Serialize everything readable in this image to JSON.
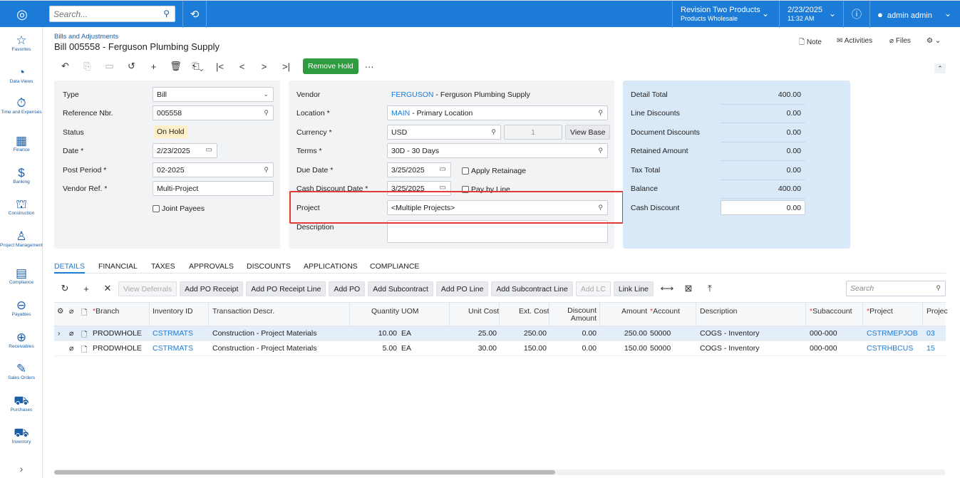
{
  "topbar": {
    "search_placeholder": "Search...",
    "company": "Revision Two Products",
    "branch": "Products Wholesale",
    "date": "2/23/2025",
    "time": "11:32 AM",
    "user": "admin admin"
  },
  "sidebar": [
    {
      "label": "Favorites",
      "icon": "star-icon",
      "glyph": "☆"
    },
    {
      "label": "Data Views",
      "icon": "pie-chart-icon",
      "glyph": "◔"
    },
    {
      "label": "Time and Expenses",
      "icon": "stopwatch-icon",
      "glyph": "⏱"
    },
    {
      "label": "Finance",
      "icon": "calculator-icon",
      "glyph": "▦"
    },
    {
      "label": "Banking",
      "icon": "dollar-icon",
      "glyph": "$"
    },
    {
      "label": "Construction",
      "icon": "crane-icon",
      "glyph": "⛫"
    },
    {
      "label": "Project Management",
      "icon": "people-icon",
      "glyph": "♙"
    },
    {
      "label": "Compliance",
      "icon": "document-icon",
      "glyph": "▤"
    },
    {
      "label": "Payables",
      "icon": "minus-circle-icon",
      "glyph": "⊖"
    },
    {
      "label": "Receivables",
      "icon": "plus-circle-icon",
      "glyph": "⊕"
    },
    {
      "label": "Sales Orders",
      "icon": "pencil-icon",
      "glyph": "✎"
    },
    {
      "label": "Purchases",
      "icon": "cart-icon",
      "glyph": "⛟"
    },
    {
      "label": "Inventory",
      "icon": "truck-icon",
      "glyph": "⛟"
    }
  ],
  "header": {
    "breadcrumb": "Bills and Adjustments",
    "title": "Bill 005558 - Ferguson Plumbing Supply",
    "note": "Note",
    "activities": "Activities",
    "files": "Files"
  },
  "toolbar": {
    "remove_hold": "Remove Hold",
    "more": "···"
  },
  "form": {
    "type_label": "Type",
    "type_value": "Bill",
    "ref_label": "Reference Nbr.",
    "ref_value": "005558",
    "status_label": "Status",
    "status_value": "On Hold",
    "date_label": "Date *",
    "date_value": "2/23/2025",
    "period_label": "Post Period *",
    "period_value": "02-2025",
    "vendorref_label": "Vendor Ref. *",
    "vendorref_value": "Multi-Project",
    "joint_payees": "Joint Payees",
    "vendor_label": "Vendor",
    "vendor_id": "FERGUSON",
    "vendor_name": " - Ferguson Plumbing Supply",
    "location_label": "Location *",
    "location_id": "MAIN",
    "location_name": " - Primary Location",
    "currency_label": "Currency *",
    "currency_value": "USD",
    "currency_rate": "1",
    "view_base": "View Base",
    "terms_label": "Terms *",
    "terms_value": "30D - 30 Days",
    "due_label": "Due Date *",
    "due_value": "3/25/2025",
    "apply_retainage": "Apply Retainage",
    "cashdisc_label": "Cash Discount Date *",
    "cashdisc_value": "3/25/2025",
    "pay_by_line": "Pay by Line",
    "project_label": "Project",
    "project_value": "<Multiple Projects>",
    "desc_label": "Description",
    "desc_value": ""
  },
  "summary": [
    {
      "label": "Detail Total",
      "value": "400.00"
    },
    {
      "label": "Line Discounts",
      "value": "0.00"
    },
    {
      "label": "Document Discounts",
      "value": "0.00"
    },
    {
      "label": "Retained Amount",
      "value": "0.00"
    },
    {
      "label": "Tax Total",
      "value": "0.00"
    },
    {
      "label": "Balance",
      "value": "400.00"
    },
    {
      "label": "Cash Discount",
      "value": "0.00"
    }
  ],
  "tabs": [
    "DETAILS",
    "FINANCIAL",
    "TAXES",
    "APPROVALS",
    "DISCOUNTS",
    "APPLICATIONS",
    "COMPLIANCE"
  ],
  "grid_toolbar": {
    "view_deferrals": "View Deferrals",
    "add_po_receipt": "Add PO Receipt",
    "add_po_receipt_line": "Add PO Receipt Line",
    "add_po": "Add PO",
    "add_subcontract": "Add Subcontract",
    "add_po_line": "Add PO Line",
    "add_subcontract_line": "Add Subcontract Line",
    "add_lc": "Add LC",
    "link_line": "Link Line",
    "search_placeholder": "Search"
  },
  "grid": {
    "columns": {
      "branch": "Branch",
      "inventory_id": "Inventory ID",
      "tran_descr": "Transaction Descr.",
      "quantity": "Quantity",
      "uom": "UOM",
      "unit_cost": "Unit Cost",
      "ext_cost": "Ext. Cost",
      "discount_amount_1": "Discount",
      "discount_amount_2": "Amount",
      "amount": "Amount",
      "account": "Account",
      "description": "Description",
      "subaccount": "Subaccount",
      "project": "Project",
      "project_task": "Projec"
    },
    "rows": [
      {
        "branch": "PRODWHOLE",
        "inventory_id": "CSTRMATS",
        "descr": "Construction - Project Materials",
        "qty": "10.00",
        "uom": "EA",
        "unit_cost": "25.00",
        "ext_cost": "250.00",
        "discount": "0.00",
        "amount": "250.00",
        "account": "50000",
        "description": "COGS - Inventory",
        "subaccount": "000-000",
        "project": "CSTRMEPJOB",
        "task": "03"
      },
      {
        "branch": "PRODWHOLE",
        "inventory_id": "CSTRMATS",
        "descr": "Construction - Project Materials",
        "qty": "5.00",
        "uom": "EA",
        "unit_cost": "30.00",
        "ext_cost": "150.00",
        "discount": "0.00",
        "amount": "150.00",
        "account": "50000",
        "description": "COGS - Inventory",
        "subaccount": "000-000",
        "project": "CSTRHBCUS",
        "task": "15"
      }
    ]
  }
}
